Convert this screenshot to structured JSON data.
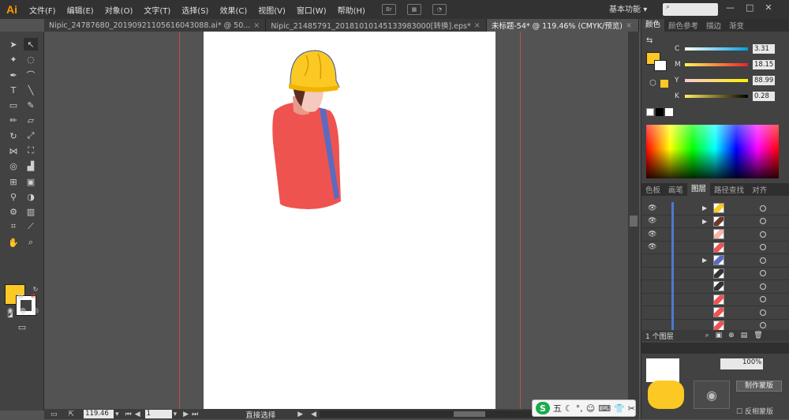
{
  "app": {
    "logo": "Ai"
  },
  "menu": [
    "文件(F)",
    "编辑(E)",
    "对象(O)",
    "文字(T)",
    "选择(S)",
    "效果(C)",
    "视图(V)",
    "窗口(W)",
    "帮助(H)"
  ],
  "topbar": {
    "workspace": "基本功能",
    "workspace_arrow": "▾",
    "search_icon": "search-icon"
  },
  "tabs": [
    {
      "label": "Nipic_24787680_20190921105616043088.ai* @ 50...",
      "active": false
    },
    {
      "label": "Nipic_21485791_20181010145133983000[转换].eps*",
      "active": false
    },
    {
      "label": "未标题-54* @ 119.46% (CMYK/预览)",
      "active": true
    }
  ],
  "tab_close": "×",
  "status": {
    "zoom": "119.46",
    "page": "1",
    "tool": "直接选择"
  },
  "color_panel": {
    "tabs": [
      "颜色",
      "颜色参考",
      "描边",
      "渐变"
    ],
    "channels": [
      {
        "label": "C",
        "value": "3.31",
        "gradient": "linear-gradient(to right,#fff,#00a0e0)"
      },
      {
        "label": "M",
        "value": "18.15",
        "gradient": "linear-gradient(to right,#fff55a,#e8232a)"
      },
      {
        "label": "Y",
        "value": "88.99",
        "gradient": "linear-gradient(to right,#f7c9d6,#fff000)"
      },
      {
        "label": "K",
        "value": "0.28",
        "gradient": "linear-gradient(to right,#fff060,#000)"
      }
    ],
    "fill_color": "#fcc824"
  },
  "layers_panel": {
    "tabs": [
      "色板",
      "画笔",
      "图层",
      "路径查找",
      "对齐"
    ],
    "footer": "1 个图层",
    "rows": [
      {
        "eye": true,
        "arrow": true,
        "thumb_color": "#fcc824"
      },
      {
        "eye": true,
        "arrow": true,
        "thumb_color": "#6b3a2a"
      },
      {
        "eye": true,
        "arrow": false,
        "thumb_color": "#f5b5a8"
      },
      {
        "eye": true,
        "arrow": false,
        "thumb_color": "#ef5350"
      },
      {
        "eye": false,
        "arrow": true,
        "thumb_color": "#5c6bc0"
      },
      {
        "eye": false,
        "arrow": false,
        "thumb_color": "#333333"
      },
      {
        "eye": false,
        "arrow": false,
        "thumb_color": "#333333"
      },
      {
        "eye": false,
        "arrow": false,
        "thumb_color": "#ef5350"
      },
      {
        "eye": false,
        "arrow": false,
        "thumb_color": "#ef5350"
      },
      {
        "eye": false,
        "arrow": false,
        "thumb_color": "#ef5350"
      }
    ]
  },
  "bottom_panel": {
    "label": "制作蒙版",
    "checkbox_label": "反相蒙版",
    "zoom_pct": "100%"
  },
  "ime": {
    "logo": "S",
    "mode": "五"
  },
  "artwork": {
    "helmet_color": "#fcc824",
    "shirt_color": "#ef5350",
    "skin_color": "#f5b5a8",
    "strap_color": "#5c6bc0",
    "hair_color": "#6b3a2a"
  }
}
